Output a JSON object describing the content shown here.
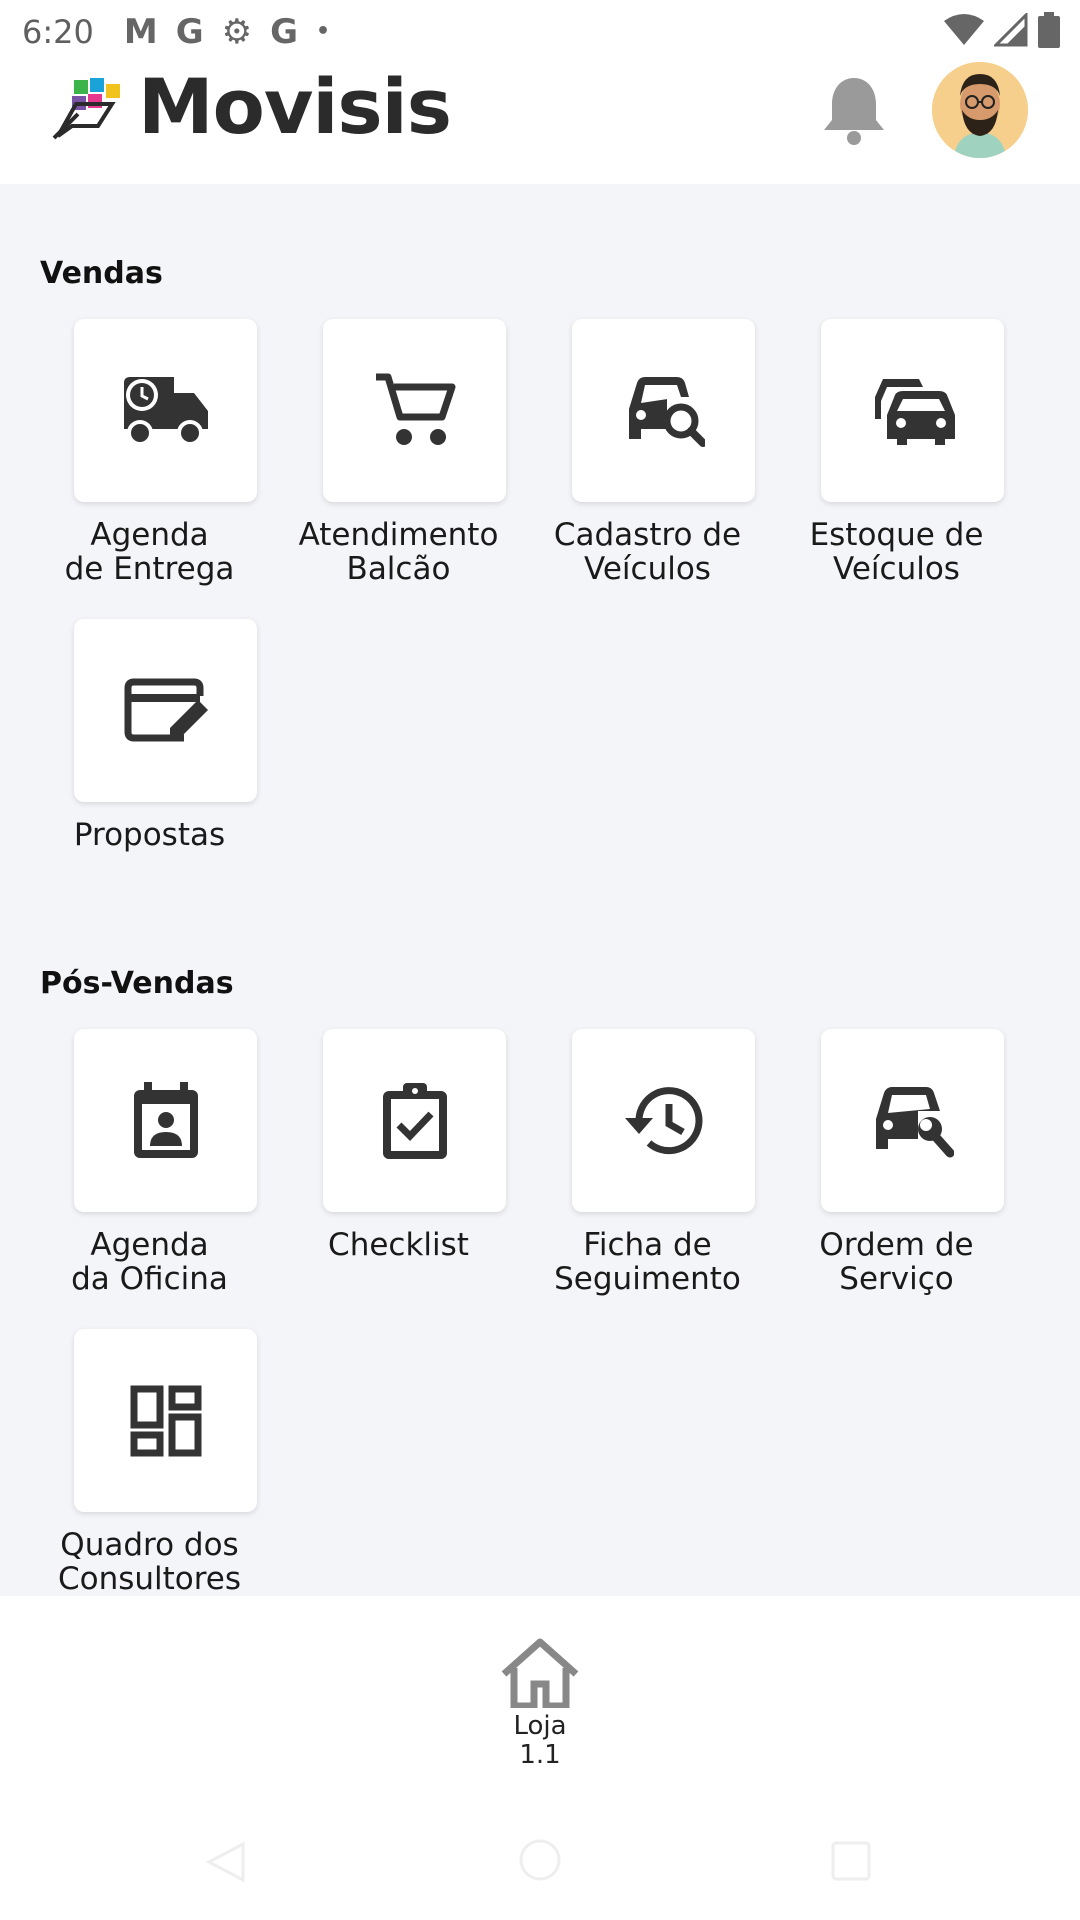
{
  "status_bar": {
    "time": "6:20",
    "notif_icons": [
      "M",
      "G",
      "⚙",
      "G",
      "•"
    ]
  },
  "header": {
    "app_name": "Movisis"
  },
  "sections": {
    "vendas": {
      "title": "Vendas",
      "tiles": [
        {
          "label1": "Agenda",
          "label2": "de Entrega",
          "icon": "delivery-truck-icon"
        },
        {
          "label1": "Atendimento",
          "label2": "Balcão",
          "icon": "shopping-cart-icon"
        },
        {
          "label1": "Cadastro de",
          "label2": "Veículos",
          "icon": "car-search-icon"
        },
        {
          "label1": "Estoque de",
          "label2": "Veículos",
          "icon": "cars-stack-icon"
        },
        {
          "label1": "Propostas",
          "label2": "",
          "icon": "card-edit-icon"
        }
      ]
    },
    "pos_vendas": {
      "title": "Pós-Vendas",
      "tiles": [
        {
          "label1": "Agenda",
          "label2": "da Oficina",
          "icon": "calendar-person-icon"
        },
        {
          "label1": "Checklist",
          "label2": "",
          "icon": "clipboard-check-icon"
        },
        {
          "label1": "Ficha de",
          "label2": "Seguimento",
          "icon": "history-icon"
        },
        {
          "label1": "Ordem de",
          "label2": "Serviço",
          "icon": "car-wrench-icon"
        },
        {
          "label1": "Quadro dos",
          "label2": "Consultores",
          "icon": "dashboard-icon"
        }
      ]
    }
  },
  "bottom_nav": {
    "home_label1": "Loja",
    "home_label2": "1.1"
  },
  "colors": {
    "background": "#f4f5f9",
    "icon": "#333333",
    "bell": "#9a9a9a"
  }
}
